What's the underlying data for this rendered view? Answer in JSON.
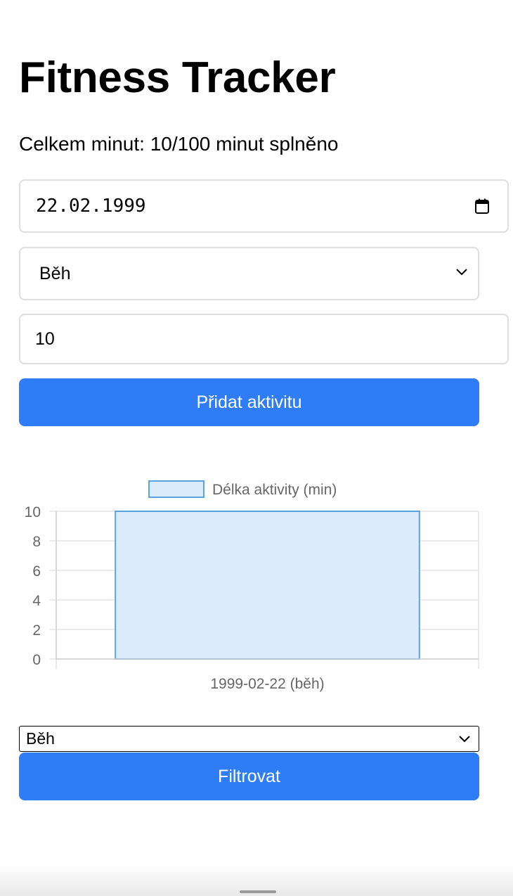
{
  "title": "Fitness Tracker",
  "summary_text": "Celkem minut: 10/100 minut splněno",
  "form": {
    "date_value": "22.02.1999",
    "activity_selected": "Běh",
    "duration_value": "10",
    "add_button_label": "Přidat aktivitu"
  },
  "filter": {
    "selected": "Běh",
    "button_label": "Filtrovat"
  },
  "icons": {
    "date_picker": "calendar-icon",
    "dropdown": "chevron-down-icon"
  },
  "colors": {
    "accent": "#2f7df6",
    "bar_fill": "#dcebfa",
    "bar_border": "#5aa2e0"
  },
  "chart_data": {
    "type": "bar",
    "categories": [
      "1999-02-22 (běh)"
    ],
    "series": [
      {
        "name": "Délka aktivity (min)",
        "values": [
          10
        ]
      }
    ],
    "ylim": [
      0,
      10
    ],
    "yticks": [
      0,
      2,
      4,
      6,
      8,
      10
    ],
    "grid": true,
    "legend": "top"
  }
}
